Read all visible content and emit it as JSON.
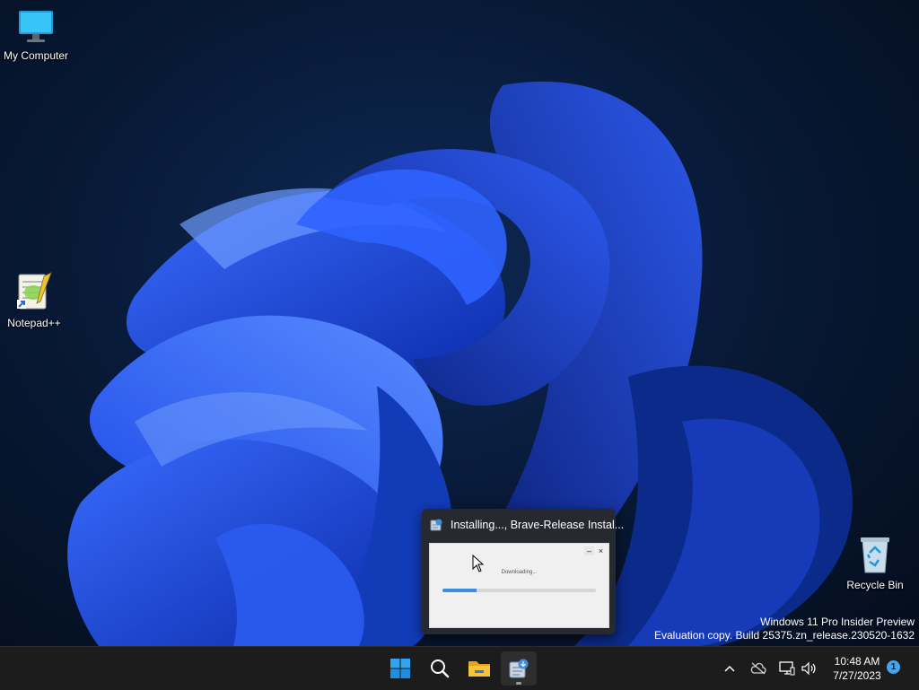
{
  "desktop": {
    "icons": [
      {
        "label": "My Computer"
      },
      {
        "label": "Notepad++"
      },
      {
        "label": "Recycle Bin"
      }
    ],
    "watermark": {
      "line1": "Windows 11 Pro Insider Preview",
      "line2": "Evaluation copy. Build 25375.zn_release.230520-1632"
    }
  },
  "preview": {
    "title": "Installing..., Brave-Release Instal...",
    "status": "Downloading...",
    "progress": 0.22,
    "minimize_glyph": "–",
    "close_glyph": "×"
  },
  "taskbar": {
    "apps": [
      {
        "name": "start-icon"
      },
      {
        "name": "search-icon"
      },
      {
        "name": "file-explorer-icon"
      },
      {
        "name": "brave-installer-icon",
        "active": true
      }
    ],
    "tray": {
      "chevron": "^",
      "time": "10:48 AM",
      "date": "7/27/2023",
      "notification_count": "1"
    }
  },
  "colors": {
    "accent": "#3d8ee0",
    "taskbar": "#1c1c1c",
    "preview": "#262a30"
  }
}
